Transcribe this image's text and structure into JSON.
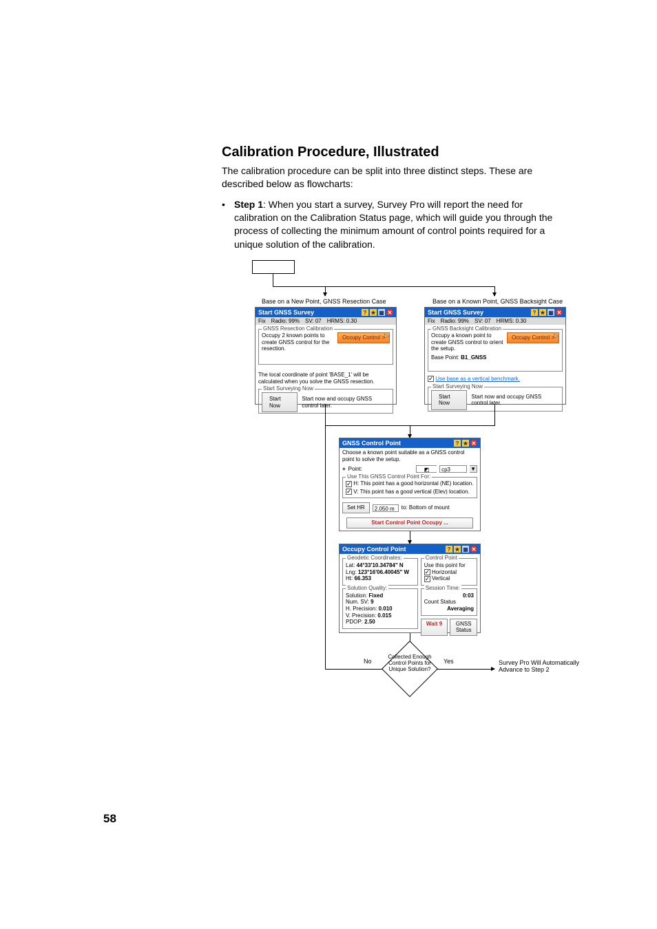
{
  "heading": "Calibration Procedure, Illustrated",
  "intro": "The calibration procedure can be split into three distinct steps. These are described below as flowcharts:",
  "bullet_label": "Step 1",
  "bullet_text": ": When you start a survey, Survey Pro will report the need for calibration on the Calibration Status page, which will guide you through the process of collecting the minimum amount of control points required for a unique solution of the calibration.",
  "page_number": "58",
  "flow": {
    "left_caption": "Base on a New Point, GNSS Resection Case",
    "right_caption": "Base on a Known Point, GNSS Backsight Case",
    "diamond_text": "Collected Enough Control Points for Unique Solution?",
    "no_label": "No",
    "yes_label": "Yes",
    "advance_text": "Survey Pro Will Automatically Advance to Step 2"
  },
  "appA": {
    "title": "Start GNSS Survey",
    "status_fix": "Fix",
    "status_radio": "Radio: 99%",
    "status_sv": "SV: 07",
    "status_hrms": "HRMS: 0.30",
    "group_title": "GNSS Resection Calibration",
    "body_text": "Occupy 2 known points to create GNSS control for the resection.",
    "btn_occupy": "Occupy Control >",
    "note": "The local coordinate of point 'BASE_1' will be calculated when you solve the GNSS resection.",
    "start_group": "Start Surveying Now",
    "btn_start": "Start Now",
    "start_note": "Start now and occupy GNSS control later."
  },
  "appB": {
    "title": "Start GNSS Survey",
    "status_fix": "Fix",
    "status_radio": "Radio: 99%",
    "status_sv": "SV: 07",
    "status_hrms": "HRMS: 0.30",
    "group_title": "GNSS Backsight Calibration",
    "body_text": "Occupy a known point to create GNSS control to orient the setup.",
    "btn_occupy": "Occupy Control >",
    "base_point_label": "Base Point:",
    "base_point_value": "B1_GNSS",
    "use_base": "Use base as a vertical benchmark.",
    "start_group": "Start Surveying Now",
    "btn_start": "Start Now",
    "start_note": "Start now and occupy GNSS control later."
  },
  "appC": {
    "title": "GNSS Control Point",
    "intro": "Choose a known point suitable as a GNSS control point to solve the setup.",
    "point_label": "Point:",
    "point_value": "cp3",
    "group_use": "Use This GNSS Control Point For:",
    "h_label": "H:",
    "h_text": "This point has a good horizontal (NE) location.",
    "v_label": "V:",
    "v_text": "This point has a good vertical (Elev) location.",
    "btn_set": "Set HR",
    "hr_value": "2.050 m",
    "to_label": "to: Bottom of mount",
    "btn_start_occupy": "Start Control Point Occupy ..."
  },
  "appD": {
    "title": "Occupy Control Point",
    "group_geo": "Geodetic Coordinates:",
    "lat_label": "Lat:",
    "lat_val": "44°33'10.34784\" N",
    "lng_label": "Lng:",
    "lng_val": "123°16'06.40045\" W",
    "ht_label": "Ht:",
    "ht_val": "66.353",
    "group_sol": "Solution Quality:",
    "solution_label": "Solution:",
    "solution_val": "Fixed",
    "numsv_label": "Num. SV:",
    "numsv_val": "9",
    "hprec_label": "H. Precision:",
    "hprec_val": "0.010",
    "vprec_label": "V. Precision:",
    "vprec_val": "0.015",
    "pdop_label": "PDOP:",
    "pdop_val": "2.50",
    "group_cp": "Control Point",
    "use_point_for": "Use this point for",
    "horizontal": "Horizontal",
    "vertical": "Vertical",
    "group_sess": "Session Time:",
    "sess_val": "0:03",
    "count_label": "Count Status",
    "count_val": "Averaging",
    "btn_wait": "Wait 9",
    "btn_gnss": "GNSS Status"
  }
}
